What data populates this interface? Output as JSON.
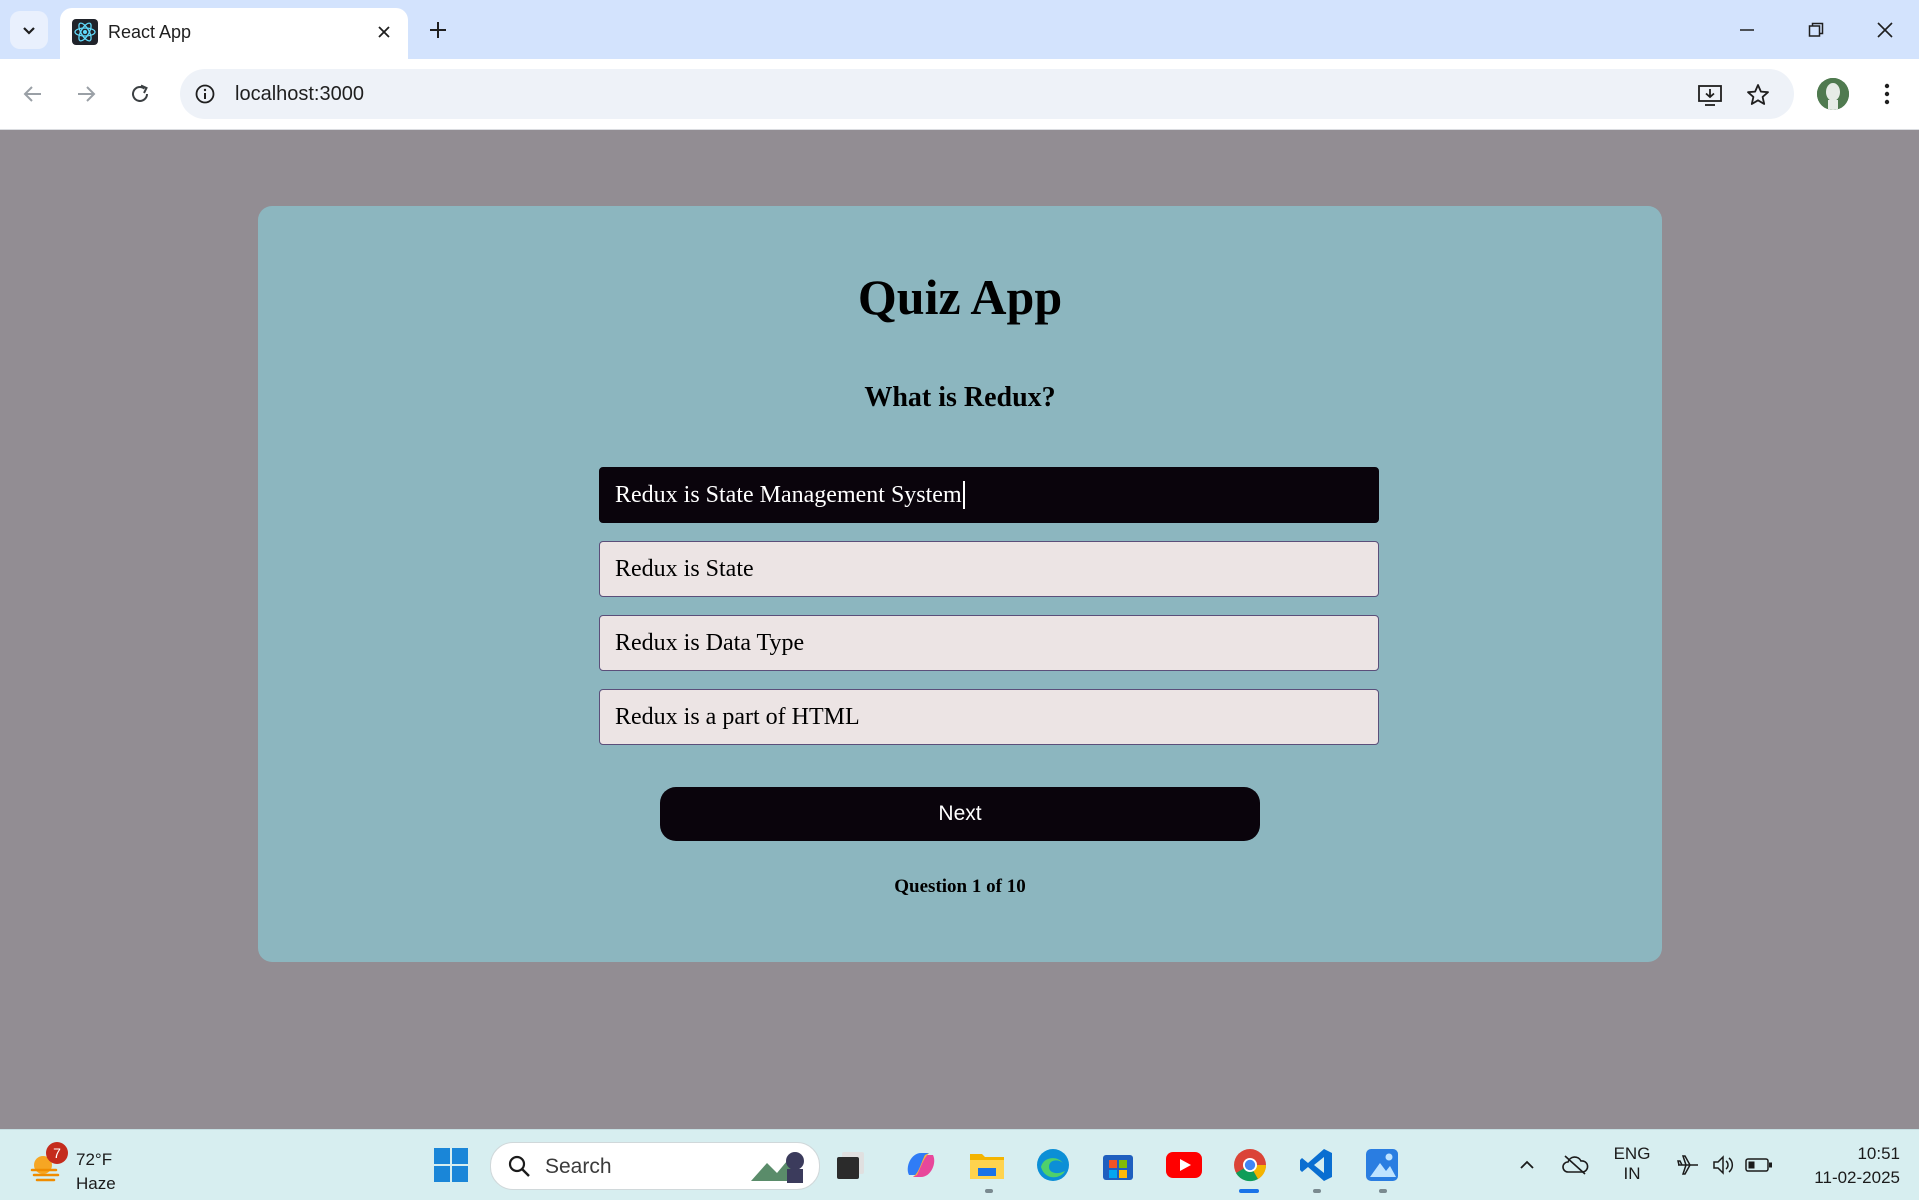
{
  "browser": {
    "tab_title": "React App",
    "url": "localhost:3000"
  },
  "quiz": {
    "title": "Quiz App",
    "question": "What is Redux?",
    "options": [
      {
        "label": "Redux is State Management System",
        "selected": true
      },
      {
        "label": "Redux is State",
        "selected": false
      },
      {
        "label": "Redux is Data Type",
        "selected": false
      },
      {
        "label": "Redux is a part of HTML",
        "selected": false
      }
    ],
    "next_label": "Next",
    "progress": "Question 1 of 10"
  },
  "taskbar": {
    "weather_badge": "7",
    "weather_temp": "72°F",
    "weather_desc": "Haze",
    "search_placeholder": "Search",
    "lang_top": "ENG",
    "lang_bottom": "IN",
    "time": "10:51",
    "date": "11-02-2025"
  },
  "colors": {
    "page_bg": "#928d93",
    "card_bg": "#8cb6bf",
    "selected_option_bg": "#0a040c",
    "option_bg": "#ece4e4",
    "button_bg": "#0a040c"
  }
}
